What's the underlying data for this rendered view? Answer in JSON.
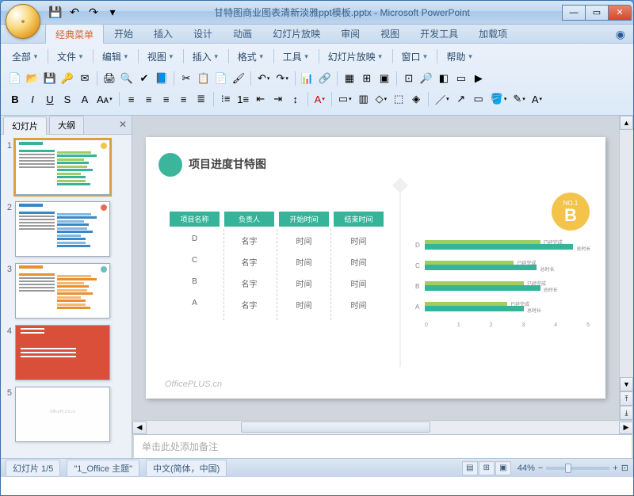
{
  "window": {
    "title": "甘特图商业图表清新淡雅ppt模板.pptx - Microsoft PowerPoint"
  },
  "qat": {
    "save": "💾",
    "undo": "↶",
    "redo": "↷"
  },
  "ribbon_tabs": [
    "经典菜单",
    "开始",
    "插入",
    "设计",
    "动画",
    "幻灯片放映",
    "审阅",
    "视图",
    "开发工具",
    "加载项"
  ],
  "classic_menus": [
    "全部",
    "文件",
    "编辑",
    "视图",
    "插入",
    "格式",
    "工具",
    "幻灯片放映",
    "窗口",
    "帮助"
  ],
  "panel": {
    "tab_slides": "幻灯片",
    "tab_outline": "大纲"
  },
  "slide": {
    "title": "项目进度甘特图",
    "badge_no": "NO.1",
    "badge_letter": "B",
    "table_headers": [
      "项目名称",
      "负责人",
      "开始时间",
      "结束时间"
    ],
    "table_rows": [
      [
        "D",
        "名字",
        "时间",
        "时间"
      ],
      [
        "C",
        "名字",
        "时间",
        "时间"
      ],
      [
        "B",
        "名字",
        "时间",
        "时间"
      ],
      [
        "A",
        "名字",
        "时间",
        "时间"
      ]
    ],
    "gantt_labels": [
      "D",
      "C",
      "B",
      "A"
    ],
    "gantt_axis": [
      "0",
      "1",
      "2",
      "3",
      "4",
      "5"
    ],
    "gantt_done": "已经完成",
    "gantt_total": "总时长",
    "watermark": "OfficePLUS.cn"
  },
  "chart_data": {
    "type": "bar",
    "orientation": "horizontal",
    "categories": [
      "D",
      "C",
      "B",
      "A"
    ],
    "series": [
      {
        "name": "已经完成",
        "color": "#9ccf5f",
        "values": [
          3.5,
          2.7,
          3.0,
          2.5
        ]
      },
      {
        "name": "总时长",
        "color": "#35b49a",
        "values": [
          4.5,
          3.4,
          3.5,
          3.0
        ]
      }
    ],
    "xlim": [
      0,
      5
    ],
    "xlabel": "",
    "ylabel": "",
    "title": "项目进度甘特图"
  },
  "notes": {
    "placeholder": "单击此处添加备注"
  },
  "status": {
    "slide_count": "幻灯片 1/5",
    "theme": "\"1_Office 主题\"",
    "lang": "中文(简体，中国)",
    "zoom": "44%"
  },
  "thumbs": [
    {
      "accent": "#35b49a",
      "badge": "#f3c34a",
      "bars": [
        "#9ccf5f",
        "#35b49a"
      ]
    },
    {
      "accent": "#3a87c8",
      "badge": "#e96a5a",
      "bars": [
        "#7fb9e6",
        "#3a87c8"
      ]
    },
    {
      "accent": "#e98f2e",
      "badge": "#6cc2b8",
      "bars": [
        "#f3b970",
        "#e98f2e"
      ]
    }
  ]
}
